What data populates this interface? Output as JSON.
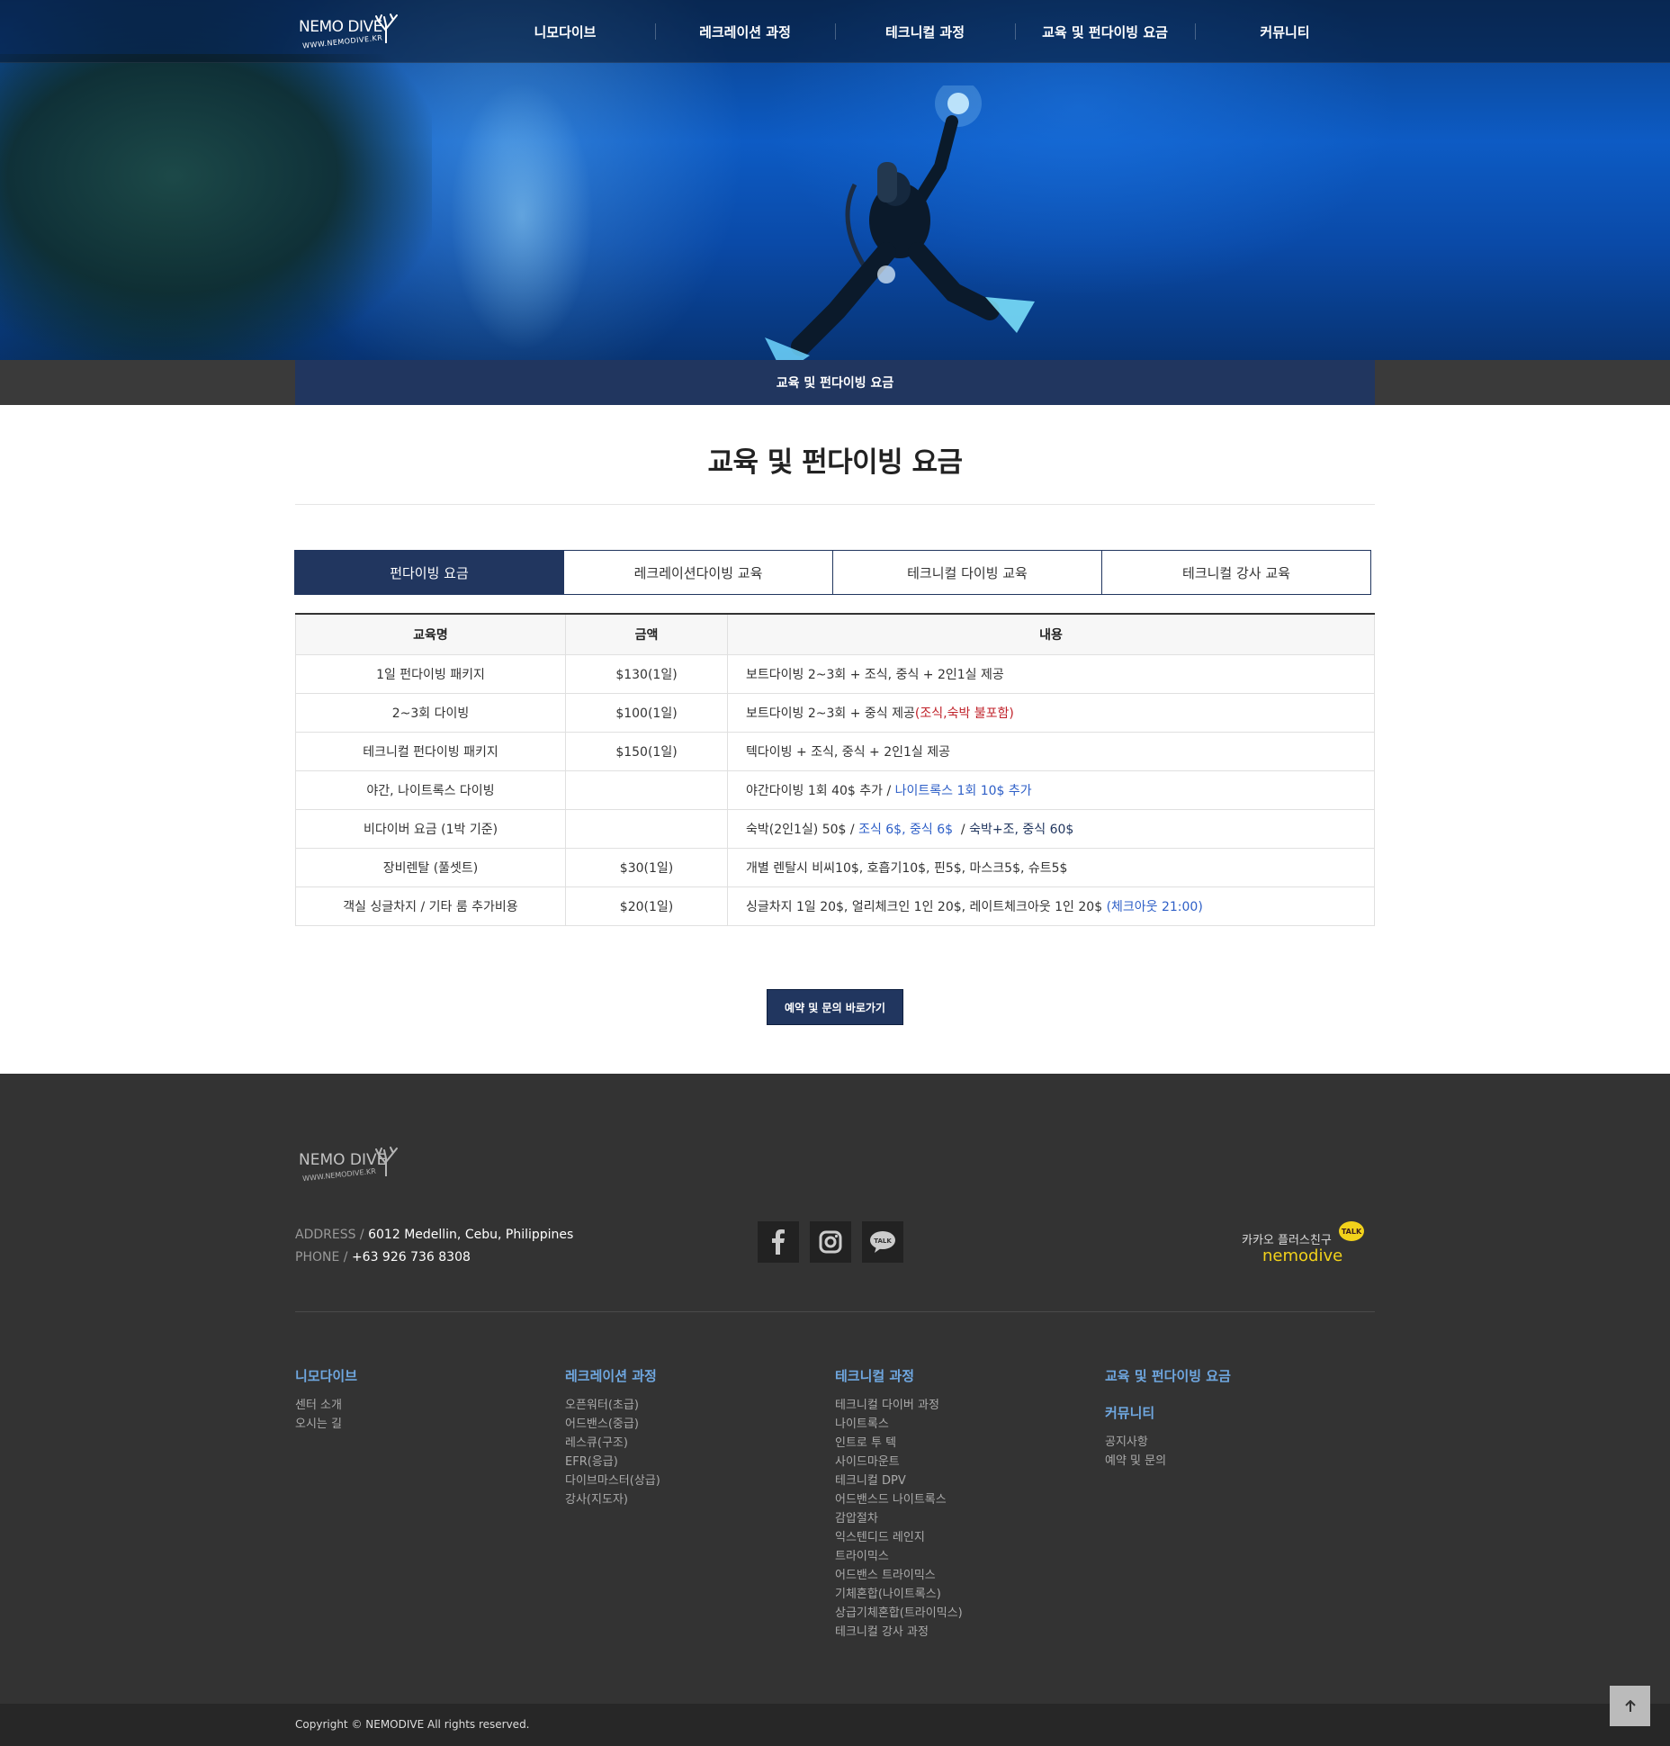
{
  "header": {
    "logo_text": "NEMO DIVE",
    "logo_sub": "WWW.NEMODIVE.KR",
    "nav": [
      "니모다이브",
      "레크레이션 과정",
      "테크니컬 과정",
      "교육 및 펀다이빙 요금",
      "커뮤니티"
    ]
  },
  "subbar": {
    "label": "교육 및 펀다이빙 요금"
  },
  "main": {
    "title": "교육 및 펀다이빙 요금",
    "tabs": [
      {
        "label": "펀다이빙 요금",
        "active": true
      },
      {
        "label": "레크레이션다이빙 교육",
        "active": false
      },
      {
        "label": "테크니컬 다이빙 교육",
        "active": false
      },
      {
        "label": "테크니컬 강사 교육",
        "active": false
      }
    ],
    "table": {
      "headers": [
        "교육명",
        "금액",
        "내용"
      ],
      "rows": [
        {
          "name": "1일 펀다이빙 패키지",
          "price": "$130(1일)",
          "desc": "보트다이빙 2~3회 + 조식, 중식 + 2인1실 제공"
        },
        {
          "name": "2~3회 다이빙",
          "price": "$100(1일)",
          "desc": "보트다이빙 2~3회 + 중식 제공",
          "desc_red": "(조식,숙박 불포함)"
        },
        {
          "name": "테크니컬 펀다이빙 패키지",
          "price": "$150(1일)",
          "desc": "텍다이빙 + 조식, 중식 + 2인1실 제공"
        },
        {
          "name": "야간, 나이트록스 다이빙",
          "price": "",
          "desc": "야간다이빙 1회 40$ 추가 / ",
          "desc_blue": "나이트록스 1회 10$ 추가"
        },
        {
          "name": "비다이버 요금 (1박 기준)",
          "price": "",
          "desc": "숙박(2인1실) 50$ / ",
          "desc_blue": "조식 6$, 중식 6$",
          "desc_sep": "  / ",
          "desc_navy": "숙박+조, 중식 60$"
        },
        {
          "name": "장비렌탈 (풀셋트)",
          "price": "$30(1일)",
          "desc": "개별 렌탈시 비씨10$, 호흡기10$, 핀5$, 마스크5$, 슈트5$"
        },
        {
          "name": "객실 싱글차지 / 기타 룸 추가비용",
          "price": "$20(1일)",
          "desc": "싱글차지 1일 20$, 얼리체크인 1인 20$, 레이트체크아웃 1인 20$ ",
          "desc_blue": "(체크아웃 21:00)"
        }
      ]
    },
    "cta_label": "예약 및 문의 바로가기"
  },
  "footer": {
    "address_label": "ADDRESS / ",
    "address": "6012 Medellin, Cebu, Philippines",
    "phone_label": "PHONE / ",
    "phone": "+63 926 736 8308",
    "kakao_line1": "카카오 플러스친구",
    "kakao_line2": "nemodive",
    "kakao_badge": "TALK",
    "social_talk": "TALK",
    "columns": [
      {
        "heading": "니모다이브",
        "links": [
          "센터 소개",
          "오시는 길"
        ]
      },
      {
        "heading": "레크레이션 과정",
        "links": [
          "오픈워터(초급)",
          "어드밴스(중급)",
          "레스큐(구조)",
          "EFR(응급)",
          "다이브마스터(상급)",
          "강사(지도자)"
        ]
      },
      {
        "heading": "테크니컬 과정",
        "links": [
          "테크니컬 다이버 과정",
          "나이트록스",
          "인트로 투 텍",
          "사이드마운트",
          "테크니컬 DPV",
          "어드밴스드 나이트록스",
          "감압절차",
          "익스텐디드 레인지",
          "트라이믹스",
          "어드밴스 트라이믹스",
          "기체혼합(나이트록스)",
          "상급기체혼합(트라이믹스)",
          "테크니컬 강사 과정"
        ]
      },
      {
        "heading": "교육 및 펀다이빙 요금",
        "heading2": "커뮤니티",
        "links": [
          "공지사항",
          "예약 및 문의"
        ]
      }
    ],
    "copyright": "Copyright © NEMODIVE All rights reserved."
  },
  "colors": {
    "navy": "#21365f",
    "footer_bg": "#333333",
    "link_blue": "#6fa7e0",
    "kakao_yellow": "#f2d21b",
    "red": "#c0222a",
    "blue": "#2e5fc7"
  }
}
